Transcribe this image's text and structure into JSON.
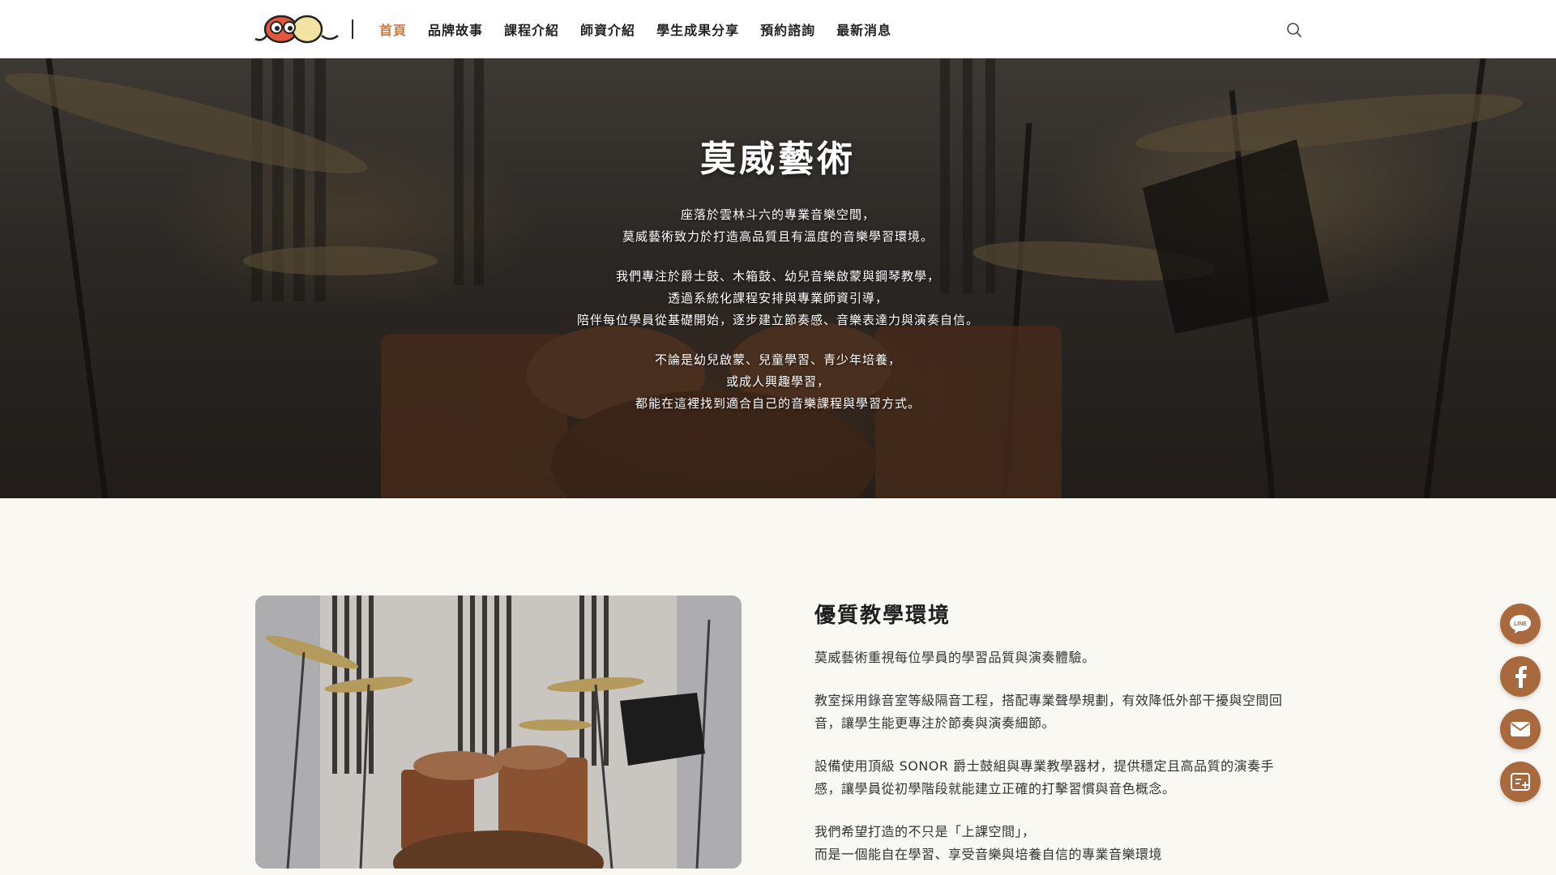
{
  "nav": {
    "items": [
      {
        "label": "首頁",
        "active": true
      },
      {
        "label": "品牌故事",
        "active": false
      },
      {
        "label": "課程介紹",
        "active": false
      },
      {
        "label": "師資介紹",
        "active": false
      },
      {
        "label": "學生成果分享",
        "active": false
      },
      {
        "label": "預約諮詢",
        "active": false
      },
      {
        "label": "最新消息",
        "active": false
      }
    ],
    "search_icon": "search-icon"
  },
  "hero": {
    "title": "莫威藝術",
    "paragraphs": [
      [
        "座落於雲林斗六的專業音樂空間，",
        "莫威藝術致力於打造高品質且有溫度的音樂學習環境。"
      ],
      [
        "我們專注於爵士鼓、木箱鼓、幼兒音樂啟蒙與鋼琴教學，",
        "透過系統化課程安排與專業師資引導，",
        "陪伴每位學員從基礎開始，逐步建立節奏感、音樂表達力與演奏自信。"
      ],
      [
        "不論是幼兒啟蒙、兒童學習、青少年培養，",
        "或成人興趣學習，",
        "都能在這裡找到適合自己的音樂課程與學習方式。"
      ]
    ]
  },
  "environment": {
    "title": "優質教學環境",
    "paragraphs": [
      "莫威藝術重視每位學員的學習品質與演奏體驗。",
      "教室採用錄音室等級隔音工程，搭配專業聲學規劃，有效降低外部干擾與空間回音，讓學生能更專注於節奏與演奏細節。",
      "設備使用頂級 SONOR 爵士鼓組與專業教學器材，提供穩定且高品質的演奏手感，讓學員從初學階段就能建立正確的打擊習慣與音色概念。",
      "我們希望打造的不只是「上課空間」，\n而是一個能自在學習、享受音樂與培養自信的專業音樂環境"
    ]
  },
  "floating_buttons": {
    "line_label": "LINE",
    "icons": [
      "line-icon",
      "facebook-icon",
      "mail-icon",
      "booking-icon"
    ]
  },
  "colors": {
    "accent": "#c47a44",
    "float_button": "#a86a3d",
    "background": "#faf8f3"
  }
}
